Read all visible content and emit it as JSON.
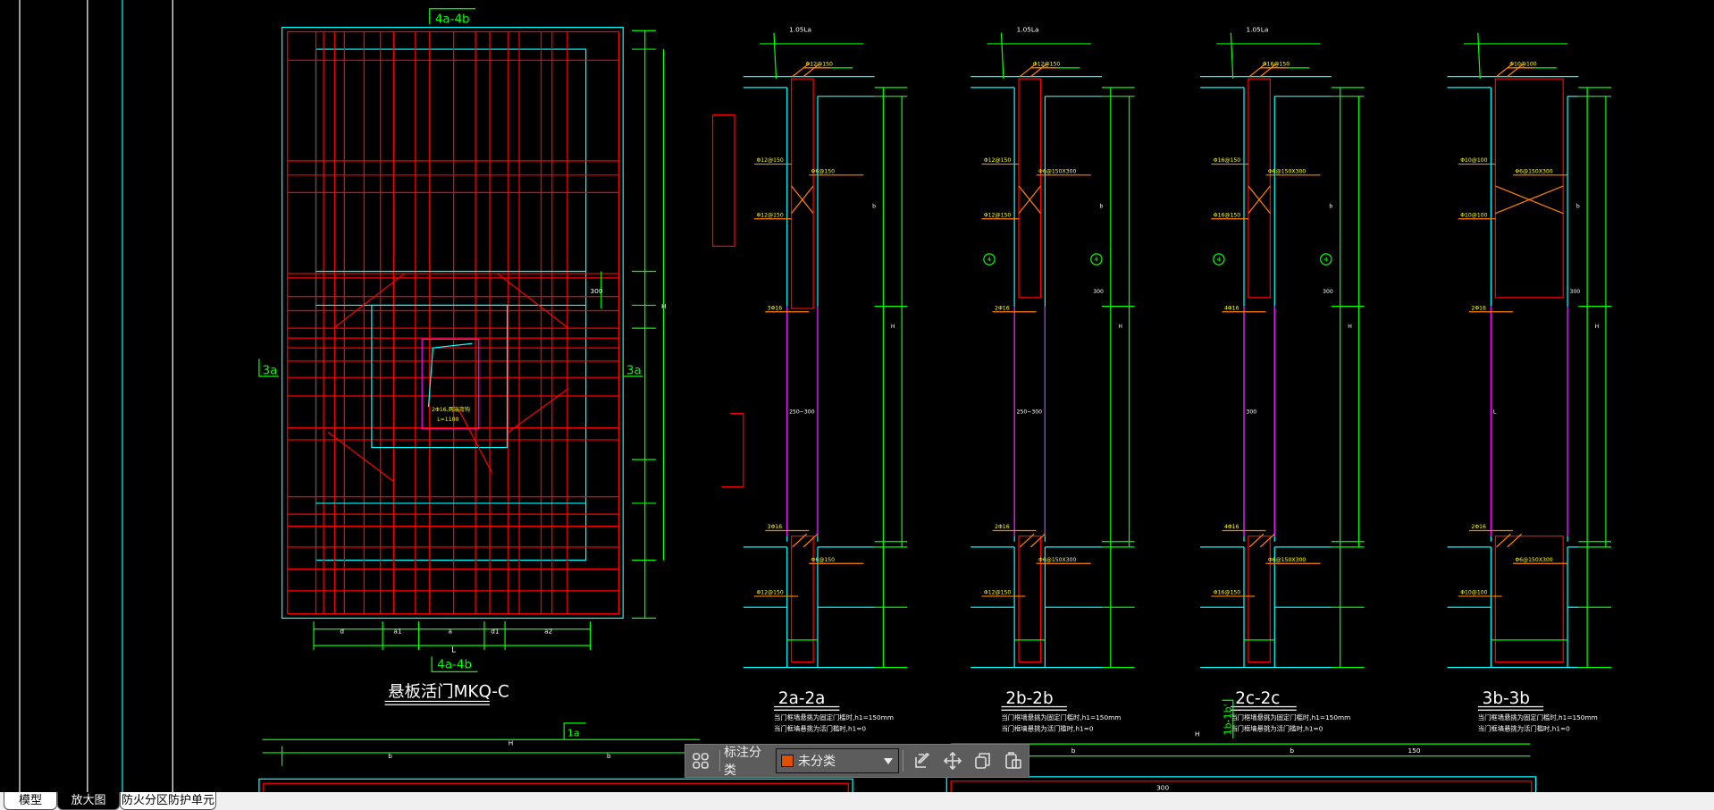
{
  "colors": {
    "background": "#000000",
    "wall": "#00ffff",
    "rebar": "#ff0000",
    "dimension": "#00ff00",
    "leader": "#ff8000",
    "note": "#ffff00",
    "text": "#ffffff",
    "opening": "#ff00ff",
    "category_swatch": "#e05000"
  },
  "drawing": {
    "plan": {
      "section_mark_top": "4a-4b",
      "section_mark_bottom": "4a-4b",
      "side_mark_left": "3a",
      "side_mark_right": "3a",
      "title": "悬板活门MKQ-C",
      "dims_bottom": [
        "d",
        "a1",
        "a",
        "d1",
        "a2"
      ],
      "dim_total": "L",
      "dim_right_total": "H",
      "dim_300": "300",
      "hinge_note": "2Φ16,两端弯钩",
      "hinge_note2": "L=1100"
    },
    "sections": [
      {
        "title": "2a-2a",
        "top_dim1": "1.05La",
        "top_dim2": "1.05La",
        "width_label": "250~300",
        "note1": "当门框墙悬挑为固定门槛时,h1=150mm",
        "note2": "当门框墙悬挑为活门槛时,h1=0",
        "rebar1": "Φ12@150",
        "rebar2": "Φ6@150",
        "rebar3": "3Φ16",
        "dim_h": "H",
        "dim_b": "b"
      },
      {
        "title": "2b-2b",
        "top_dim1": "1.05La",
        "width_label": "250~300",
        "note1": "当门框墙悬挑为固定门槛时,h1=150mm",
        "note2": "当门框墙悬挑为活门槛时,h1=0",
        "rebar1": "Φ12@150",
        "rebar2": "Φ6@150X300",
        "rebar3": "2Φ16",
        "dim_h": "H",
        "dim_b": "b",
        "dim_300": "300",
        "bubble": "4"
      },
      {
        "title": "2c-2c",
        "top_dim1": "1.05La",
        "width_label": "300",
        "note1": "当门框墙悬挑为固定门槛时,h1=150mm",
        "note2": "当门框墙悬挑为活门槛时,h1=0",
        "rebar1": "Φ16@150",
        "rebar2": "Φ6@150X300",
        "rebar3": "4Φ16",
        "dim_h": "H",
        "dim_b": "b",
        "dim_300": "300",
        "bubble": "4"
      },
      {
        "title": "3b-3b",
        "width_label": "L",
        "note1": "当门框墙悬挑为固定门槛时,h1=150mm",
        "note2": "当门框墙悬挑为活门槛时,h1=0",
        "rebar1": "Φ10@100",
        "rebar2": "Φ6@150X300",
        "rebar3": "2Φ16",
        "dim_h": "H",
        "dim_b": "b",
        "dim_300": "300"
      }
    ],
    "bottom": {
      "dim_h": "H",
      "dim_b1": "b",
      "dim_b2": "b",
      "side_mark": "1a",
      "side_mark2": "1b-1b'",
      "dim_150": "150",
      "dim_300": "300",
      "dim_b3": "b"
    }
  },
  "toolbar": {
    "category_label": "标注分类",
    "category_value": "未分类",
    "icons": [
      "grid-icon",
      "edit-icon",
      "move-icon",
      "copy-icon",
      "paste-icon"
    ]
  },
  "tabs": [
    {
      "label": "模型",
      "active": false
    },
    {
      "label": "放大图",
      "active": true
    },
    {
      "label": "防火分区防护单元",
      "active": false
    }
  ]
}
